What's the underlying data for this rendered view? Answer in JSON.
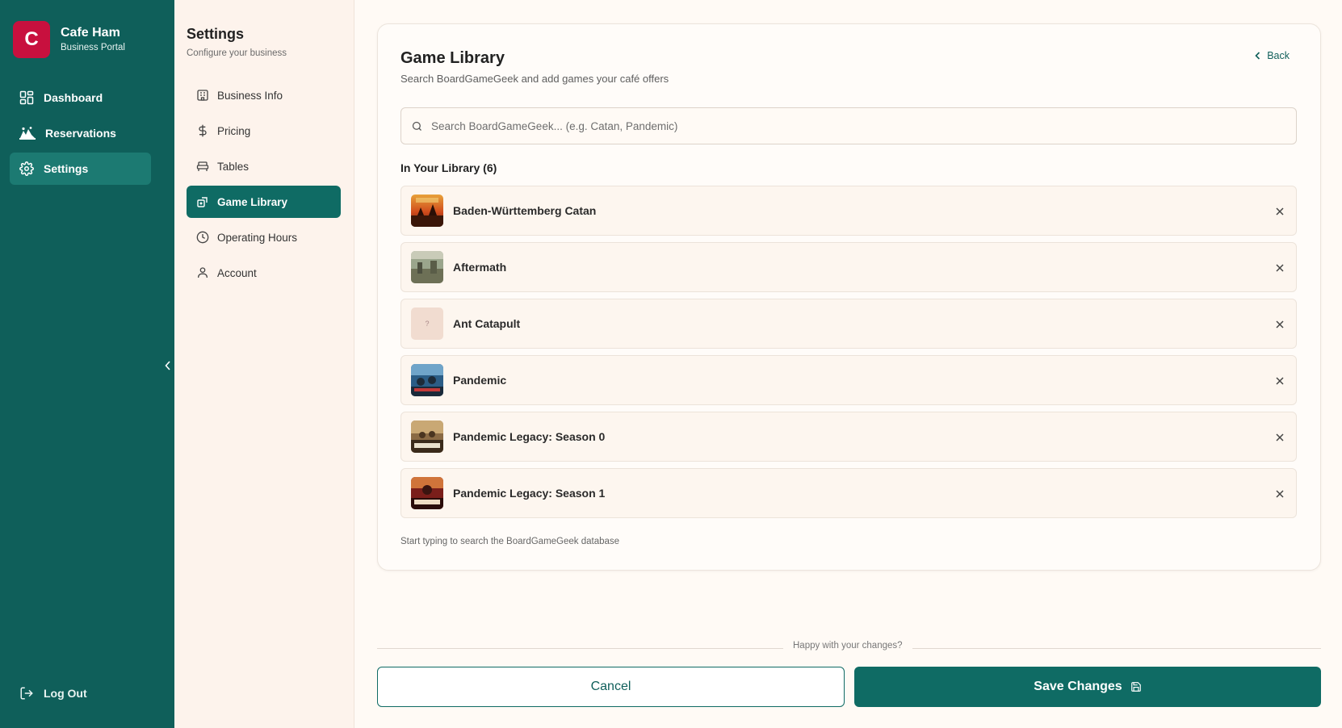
{
  "brand": {
    "initial": "C",
    "name": "Cafe Ham",
    "subtitle": "Business Portal"
  },
  "nav": {
    "items": [
      {
        "label": "Dashboard",
        "icon": "dashboard-icon"
      },
      {
        "label": "Reservations",
        "icon": "reservations-icon"
      },
      {
        "label": "Settings",
        "icon": "gear-icon",
        "active": true
      }
    ],
    "logout": "Log Out"
  },
  "settings": {
    "title": "Settings",
    "subtitle": "Configure your business",
    "items": [
      {
        "label": "Business Info",
        "icon": "building-icon"
      },
      {
        "label": "Pricing",
        "icon": "dollar-icon"
      },
      {
        "label": "Tables",
        "icon": "table-icon"
      },
      {
        "label": "Game Library",
        "icon": "game-icon",
        "active": true
      },
      {
        "label": "Operating Hours",
        "icon": "clock-icon"
      },
      {
        "label": "Account",
        "icon": "user-icon"
      }
    ]
  },
  "library": {
    "title": "Game Library",
    "subtitle": "Search BoardGameGeek and add games your café offers",
    "back": "Back",
    "search_placeholder": "Search BoardGameGeek... (e.g. Catan, Pandemic)",
    "heading": "In Your Library (6)",
    "games": [
      {
        "name": "Baden-Württemberg Catan"
      },
      {
        "name": "Aftermath"
      },
      {
        "name": "Ant Catapult",
        "placeholder": "?"
      },
      {
        "name": "Pandemic"
      },
      {
        "name": "Pandemic Legacy: Season 0"
      },
      {
        "name": "Pandemic Legacy: Season 1"
      }
    ],
    "hint": "Start typing to search the BoardGameGeek database"
  },
  "footer": {
    "prompt": "Happy with your changes?",
    "cancel": "Cancel",
    "save": "Save Changes"
  },
  "colors": {
    "primary": "#0f6b64",
    "sidebar": "#0f5f5a",
    "brand_logo": "#c8103e",
    "background": "#fffaf5"
  }
}
